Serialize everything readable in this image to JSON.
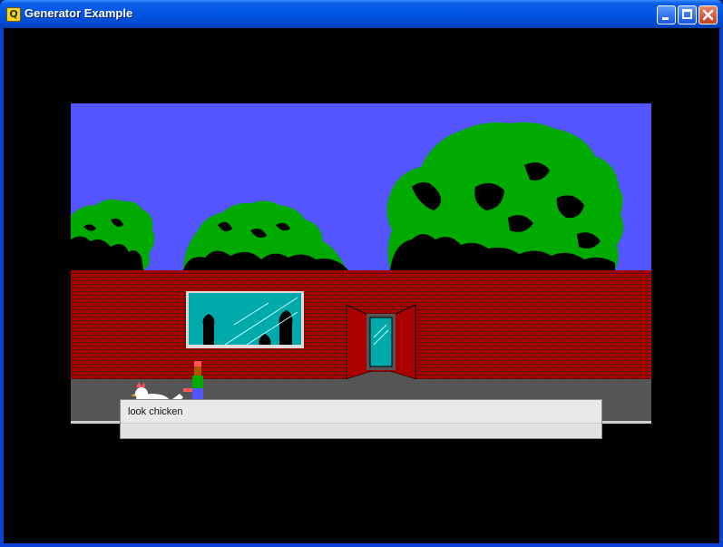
{
  "window": {
    "title": "Generator Example",
    "app_icon": "q-logo-icon",
    "buttons": [
      "minimize-icon",
      "maximize-icon",
      "close-icon"
    ]
  },
  "scene": {
    "sky_color": "#5555ff",
    "brick_color": "#aa0000",
    "foliage_color": "#00aa00",
    "window_glass_color": "#00aaaa",
    "sidewalk_color": "#555555"
  },
  "command": {
    "value": "look chicken"
  }
}
